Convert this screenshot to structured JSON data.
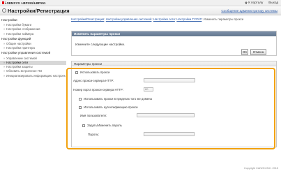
{
  "topbar": {
    "brand": "i-SENSYS",
    "model": "LBP151/LBP151",
    "home_link": "К порталу",
    "logout_link": "Выход"
  },
  "header": {
    "title": "Настройки/Регистрация",
    "admin_link": "Сообщение администратору системы"
  },
  "sidebar": {
    "sections": [
      {
        "label": "Настройки",
        "items": [
          {
            "label": "Настройки бумаги"
          },
          {
            "label": "Настройки отображения"
          },
          {
            "label": "Настройки таймера"
          }
        ]
      },
      {
        "label": "Настройки функций",
        "items": [
          {
            "label": "Общие настройки"
          },
          {
            "label": "Настройки принтера"
          }
        ]
      },
      {
        "label": "Настройки управления системой",
        "items": [
          {
            "label": "Управление системой"
          },
          {
            "label": "Настройки сети"
          },
          {
            "label": "Настройки защиты"
          },
          {
            "label": "Обновить встроенное ПО"
          },
          {
            "label": "Инициализировать информацию настроек"
          }
        ]
      }
    ]
  },
  "breadcrumb": {
    "parts": [
      "Настройки/Регистрация",
      "Настройки управления системой",
      "Настройки сети",
      "Настройки TCP/IP"
    ],
    "current": "Изменить параметры прокси"
  },
  "panel1": {
    "title": "Изменить параметры прокси",
    "message": "Измените следующие настройки.",
    "ok": "OK",
    "cancel": "Отмена"
  },
  "panel2": {
    "title": "Параметры прокси",
    "use_proxy": "Использовать прокси",
    "proxy_address_label": "Адрес прокси-сервера HTTP:",
    "proxy_port_label": "Номер порта прокси-сервера HTTP:",
    "proxy_port_value": "80",
    "same_domain": "Использовать прокси в пределах того же домена",
    "use_auth": "Использовать аутентификацию прокси",
    "username_label": "Имя пользователя:",
    "set_password": "Задать/Изменить пароль",
    "password_label": "Пароль:"
  },
  "footer": {
    "copyright": "Copyright CANON INC. 2015"
  },
  "colors": {
    "panel_header": "#6e8199",
    "highlight": "#f2a20f",
    "link": "#2b5aa8"
  }
}
